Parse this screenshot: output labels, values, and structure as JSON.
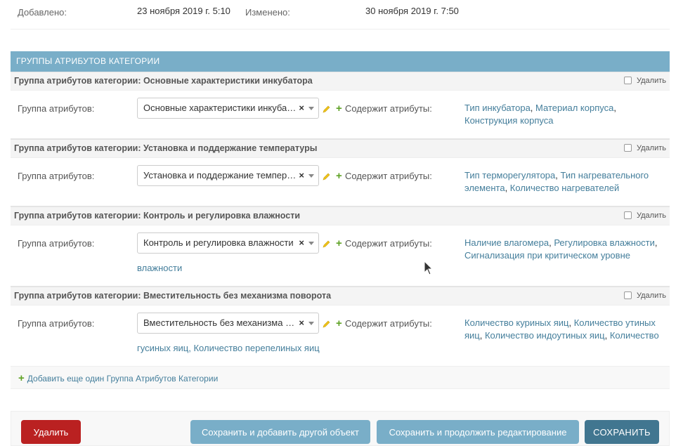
{
  "meta": {
    "added_label": "Добавлено:",
    "added_value": "23 ноября 2019 г. 5:10",
    "modified_label": "Изменено:",
    "modified_value": "30 ноября 2019 г. 7:50"
  },
  "inline": {
    "title": "ГРУППЫ АТРИБУТОВ КАТЕГОРИИ",
    "field_label": "Группа атрибутов:",
    "contains_label": "Содержит атрибуты:",
    "delete_label": "Удалить",
    "groups": [
      {
        "header": "Группа атрибутов категории: Основные характеристики инкубатора",
        "select_value": "Основные характеристики инкуба…",
        "links": [
          "Тип инкубатора",
          "Материал корпуса",
          "Конструкция корпуса"
        ],
        "overflow": ""
      },
      {
        "header": "Группа атрибутов категории: Установка и поддержание температуры",
        "select_value": "Установка и поддержание темпер…",
        "links": [
          "Тип терморегулятора",
          "Тип нагревательного элемента",
          "Количество нагревателей"
        ],
        "overflow": ""
      },
      {
        "header": "Группа атрибутов категории: Контроль и регулировка влажности",
        "select_value": "Контроль и регулировка влажности",
        "links": [
          "Наличие влагомера",
          "Регулировка влажности",
          "Сигнализация при критическом уровне"
        ],
        "overflow": "влажности"
      },
      {
        "header": "Группа атрибутов категории: Вместительность без механизма поворота",
        "select_value": "Вместительность без механизма п…",
        "links": [
          "Количество куриных яиц",
          "Количество утиных яиц",
          "Количество индоутиных яиц",
          "Количество"
        ],
        "overflow": "гусиных яиц, Количество перепелиных яиц"
      }
    ],
    "add_another": "Добавить еще один Группа Атрибутов Категории"
  },
  "clear_symbol": "×",
  "plus_symbol": "+",
  "buttons": {
    "delete": "Удалить",
    "save_add": "Сохранить и добавить другой объект",
    "save_continue": "Сохранить и продолжить редактирование",
    "save": "СОХРАНИТЬ"
  },
  "colors": {
    "header_bg": "#79aec8",
    "link": "#447e9b",
    "delete": "#ba2121",
    "save": "#417690",
    "add_icon": "#5fa225"
  }
}
